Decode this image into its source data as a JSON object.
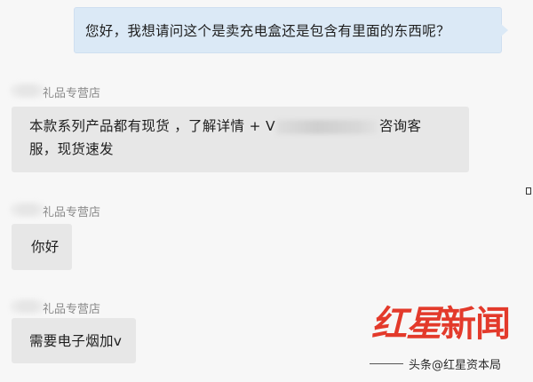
{
  "messages": [
    {
      "direction": "outgoing",
      "text": "您好，我想请问这个是卖充电盒还是包含有里面的东西呢？"
    },
    {
      "direction": "incoming",
      "sender": "礼品专营店",
      "text_line1_before": "本款系列产品都有现货 ，了解详情 + V",
      "text_line1_after": "咨询客",
      "text_line2": "服，现货速发"
    },
    {
      "direction": "incoming",
      "sender": "礼品专营店",
      "text": "你好"
    },
    {
      "direction": "incoming",
      "sender": "礼品专营店",
      "text": "需要电子烟加v"
    }
  ],
  "watermark": {
    "title_part1": "红星",
    "title_part2": "新闻",
    "subtitle": "头条@红星资本局"
  },
  "colors": {
    "outgoing_bubble": "#dbe9f6",
    "incoming_bubble": "#e7e7e7",
    "watermark_red": "#e33a2b"
  }
}
